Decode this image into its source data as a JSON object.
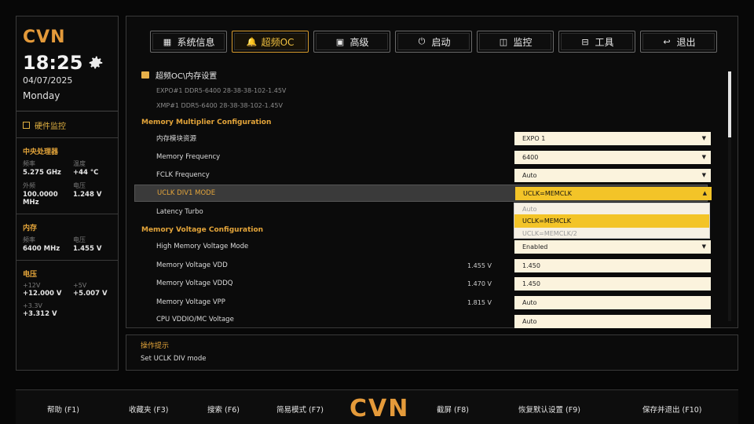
{
  "brand": {
    "logo_text": "CVN"
  },
  "clock": {
    "time": "18:25",
    "date": "04/07/2025",
    "day": "Monday"
  },
  "hw_monitor": {
    "title": "硬件监控",
    "cpu": {
      "title": "中央处理器",
      "freq_label": "频率",
      "freq_value": "5.275 GHz",
      "temp_label": "温度",
      "temp_value": "+44 °C",
      "ext_label": "外频",
      "ext_value": "100.0000 MHz",
      "volt_label": "电压",
      "volt_value": "1.248 V"
    },
    "memory": {
      "title": "内存",
      "freq_label": "频率",
      "freq_value": "6400 MHz",
      "volt_label": "电压",
      "volt_value": "1.455 V"
    },
    "voltage": {
      "title": "电压",
      "v12_label": "+12V",
      "v12_value": "+12.000 V",
      "v5_label": "+5V",
      "v5_value": "+5.007 V",
      "v33_label": "+3.3V",
      "v33_value": "+3.312 V"
    }
  },
  "tabs": [
    {
      "label": "系统信息",
      "icon": "grid-icon"
    },
    {
      "label": "超频OC",
      "icon": "bell-icon"
    },
    {
      "label": "高级",
      "icon": "briefcase-icon"
    },
    {
      "label": "启动",
      "icon": "power-icon"
    },
    {
      "label": "监控",
      "icon": "monitor-icon"
    },
    {
      "label": "工具",
      "icon": "toolbox-icon"
    },
    {
      "label": "退出",
      "icon": "back-arrow-icon"
    }
  ],
  "breadcrumb": "超频OC\\内存设置",
  "profiles": {
    "expo": "EXPO#1 DDR5-6400 28-38-38-102-1.45V",
    "xmp": "XMP#1 DDR5-6400 28-38-38-102-1.45V"
  },
  "sections": {
    "multiplier": "Memory Multiplier Configuration",
    "voltage": "Memory Voltage Configuration"
  },
  "settings": [
    {
      "label": "内存模块资源",
      "value": "EXPO 1",
      "reading": ""
    },
    {
      "label": "Memory Frequency",
      "value": "6400",
      "reading": ""
    },
    {
      "label": "FCLK Frequency",
      "value": "Auto",
      "reading": ""
    },
    {
      "label": "UCLK DIV1 MODE",
      "value": "UCLK=MEMCLK",
      "reading": ""
    },
    {
      "label": "Latency Turbo",
      "value": "",
      "reading": ""
    },
    {
      "label": "High Memory Voltage Mode",
      "value": "Enabled",
      "reading": ""
    },
    {
      "label": "Memory Voltage VDD",
      "value": "1.450",
      "reading": "1.455 V"
    },
    {
      "label": "Memory Voltage VDDQ",
      "value": "1.450",
      "reading": "1.470 V"
    },
    {
      "label": "Memory Voltage VPP",
      "value": "Auto",
      "reading": "1.815 V"
    },
    {
      "label": "CPU VDDIO/MC Voltage",
      "value": "Auto",
      "reading": ""
    }
  ],
  "dropdown_options": [
    "Auto",
    "UCLK=MEMCLK",
    "UCLK=MEMCLK/2"
  ],
  "help": {
    "title": "操作提示",
    "text": "Set UCLK DIV mode"
  },
  "footer": [
    {
      "label": "帮助 (F1)"
    },
    {
      "label": "收藏夹 (F3)"
    },
    {
      "label": "搜索 (F6)"
    },
    {
      "label": "简易模式 (F7)"
    },
    {
      "label": "截屏 (F8)"
    },
    {
      "label": "恢复默认设置 (F9)"
    },
    {
      "label": "保存并退出 (F10)"
    }
  ],
  "colors": {
    "accent": "#e4a53a",
    "highlight": "#f3c428",
    "field": "#fbf3dd"
  }
}
